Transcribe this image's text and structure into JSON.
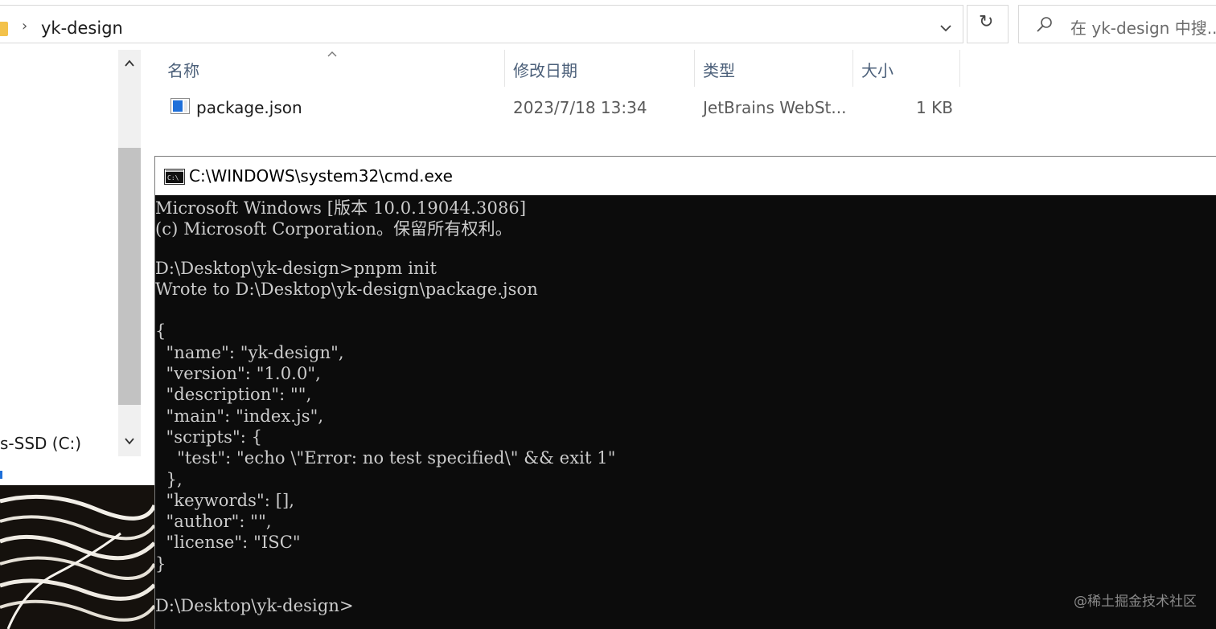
{
  "explorer": {
    "breadcrumb_sep": "›",
    "current_folder": "yk-design",
    "refresh_glyph": "↻",
    "search_placeholder": "在 yk-design 中搜...",
    "nav_drive_label": "s-SSD (C:)",
    "columns": {
      "name": "名称",
      "modified": "修改日期",
      "type": "类型",
      "size": "大小"
    },
    "files": [
      {
        "name": "package.json",
        "modified": "2023/7/18 13:34",
        "type": "JetBrains WebSt...",
        "size": "1 KB",
        "icon": "json-file-icon"
      }
    ]
  },
  "cmd": {
    "title": "C:\\WINDOWS\\system32\\cmd.exe",
    "lines": [
      "Microsoft Windows [版本 10.0.19044.3086]",
      "(c) Microsoft Corporation。保留所有权利。",
      "",
      "D:\\Desktop\\yk-design>pnpm init",
      "Wrote to D:\\Desktop\\yk-design\\package.json",
      "",
      "{",
      "  \"name\": \"yk-design\",",
      "  \"version\": \"1.0.0\",",
      "  \"description\": \"\",",
      "  \"main\": \"index.js\",",
      "  \"scripts\": {",
      "    \"test\": \"echo \\\"Error: no test specified\\\" && exit 1\"",
      "  },",
      "  \"keywords\": [],",
      "  \"author\": \"\",",
      "  \"license\": \"ISC\"",
      "}",
      "",
      "D:\\Desktop\\yk-design>"
    ]
  },
  "watermark": "@稀土掘金技术社区",
  "colors": {
    "console_bg": "#0c0c0c",
    "console_text": "#cccccc",
    "header_text": "#4c607a",
    "scroll_thumb": "#c2c2c2"
  }
}
